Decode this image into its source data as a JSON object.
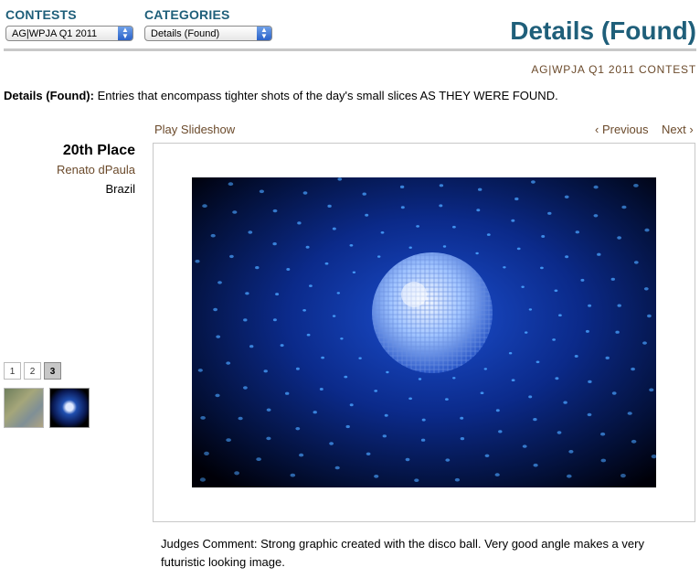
{
  "contests": {
    "label": "CONTESTS",
    "selected": "AG|WPJA Q1 2011"
  },
  "categories": {
    "label": "CATEGORIES",
    "selected": "Details (Found)"
  },
  "page_title": "Details (Found)",
  "contest_name": "AG|WPJA Q1 2011 CONTEST",
  "description": {
    "label": "Details (Found):",
    "text": "Entries that encompass tighter shots of the day's small slices AS THEY WERE FOUND."
  },
  "controls": {
    "slideshow": "Play Slideshow",
    "previous": "‹ Previous",
    "next": "Next ›"
  },
  "entry": {
    "place": "20th Place",
    "photographer": "Renato dPaula",
    "country": "Brazil"
  },
  "pages": [
    "1",
    "2",
    "3"
  ],
  "active_page": "3",
  "judges_comment": "Judges Comment: Strong graphic created with the disco ball. Very good angle makes a very futuristic looking image.",
  "colors": {
    "heading": "#1f5f7a",
    "link": "#6b4a2b"
  }
}
